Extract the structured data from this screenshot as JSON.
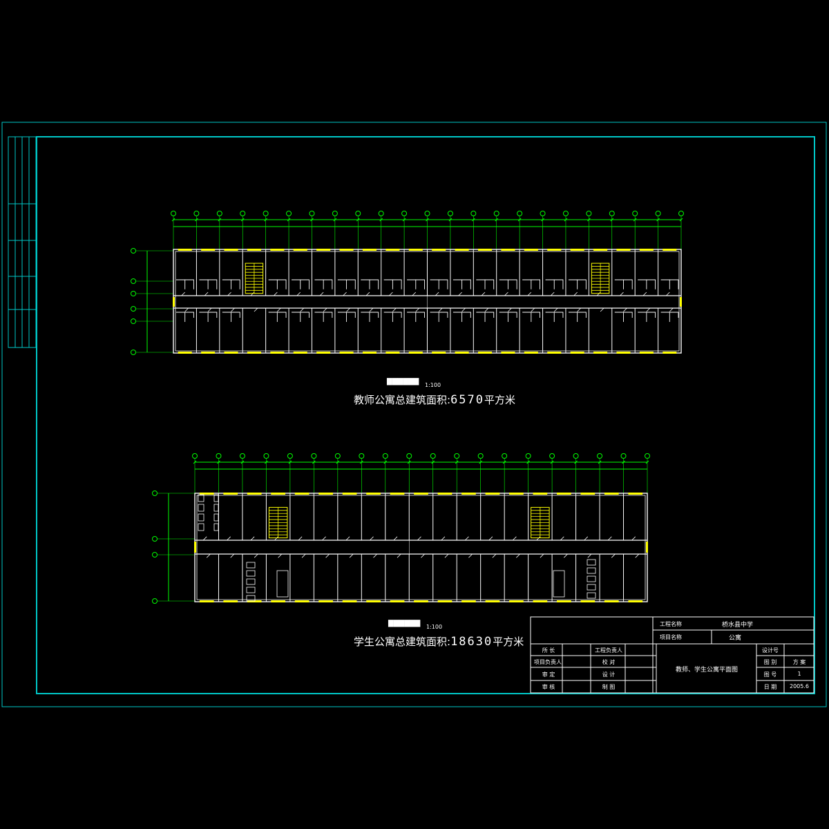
{
  "colors": {
    "background": "#000000",
    "frame": "#00c8c8",
    "wall": "#ffffff",
    "window": "#ffff00",
    "axis": "#00ff00",
    "text": "#ffffff"
  },
  "plan_teacher": {
    "scale": "1:100",
    "area_label": "教师公寓总建筑面积:",
    "area_value": "6570",
    "area_unit": "平方米",
    "axis_count": 23,
    "rows": 5
  },
  "plan_student": {
    "scale": "1:100",
    "area_label": "学生公寓总建筑面积:",
    "area_value": "18630",
    "area_unit": "平方米",
    "axis_count": 20,
    "rows": 4
  },
  "title_block": {
    "project_label": "工程名称",
    "project_value": "桥水县中学",
    "item_label": "项目名称",
    "item_value": "公寓",
    "drawing_title": "教师、学生公寓平面图",
    "roles": [
      "所 长",
      "项目负责人",
      "审 定",
      "审 核"
    ],
    "roles2": [
      "工程负责人",
      "校 对",
      "设 计",
      "制 图"
    ],
    "right_labels": [
      "设计号",
      "图 别",
      "图 号",
      "日 期"
    ],
    "right_values": [
      "",
      "方 案",
      "1",
      "2005.6"
    ]
  }
}
